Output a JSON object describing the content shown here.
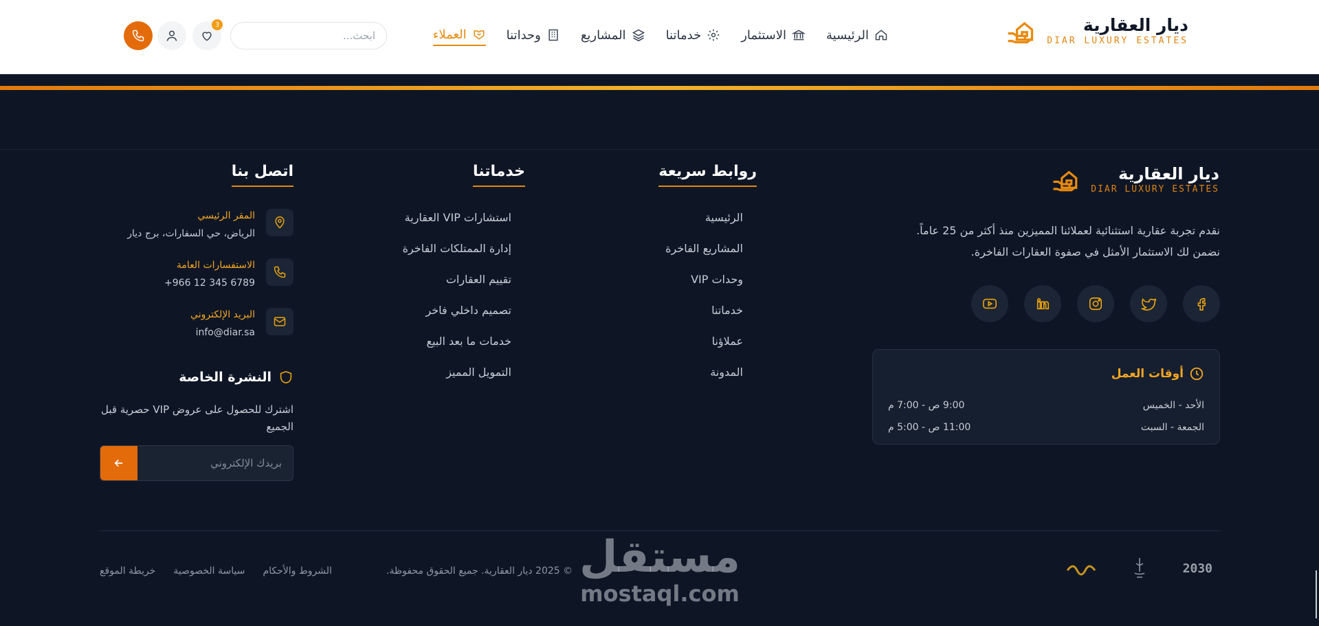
{
  "brand": {
    "title": "ديار العقارية",
    "subtitle": "DIAR LUXURY ESTATES"
  },
  "nav": [
    {
      "label": "الرئيسية",
      "icon": "home-icon"
    },
    {
      "label": "الاستثمار",
      "icon": "bank-icon"
    },
    {
      "label": "خدماتنا",
      "icon": "gear-icon"
    },
    {
      "label": "المشاريع",
      "icon": "layers-icon"
    },
    {
      "label": "وحداتنا",
      "icon": "building-icon"
    },
    {
      "label": "العملاء",
      "icon": "handshake-icon",
      "active": true
    }
  ],
  "search": {
    "placeholder": "ابحث..."
  },
  "header_actions": {
    "wishlist_count": "3"
  },
  "footer": {
    "about": {
      "title": "ديار العقارية",
      "subtitle": "DIAR LUXURY ESTATES",
      "description_line1": "نقدم تجربة عقارية استثنائية لعملائنا المميزين منذ أكثر من 25 عاماً.",
      "description_line2": "نضمن لك الاستثمار الأمثل في صفوة العقارات الفاخرة."
    },
    "socials": [
      "facebook-icon",
      "twitter-icon",
      "instagram-icon",
      "linkedin-icon",
      "youtube-icon"
    ],
    "hours": {
      "title": "أوقات العمل",
      "rows": [
        {
          "days": "الأحد - الخميس",
          "time": "9:00 ص - 7:00 م"
        },
        {
          "days": "الجمعة - السبت",
          "time": "11:00 ص - 5:00 م"
        }
      ]
    },
    "quick_links": {
      "title": "روابط سريعة",
      "items": [
        "الرئيسية",
        "المشاريع الفاخرة",
        "وحدات VIP",
        "خدماتنا",
        "عملاؤنا",
        "المدونة"
      ]
    },
    "services": {
      "title": "خدماتنا",
      "items": [
        "استشارات VIP العقارية",
        "إدارة الممتلكات الفاخرة",
        "تقييم العقارات",
        "تصميم داخلي فاخر",
        "خدمات ما بعد البيع",
        "التمويل المميز"
      ]
    },
    "contact": {
      "title": "اتصل بنا",
      "items": [
        {
          "label": "المقر الرئيسي",
          "value": "الرياض، حي السفارات، برج ديار",
          "icon": "location-pin-icon"
        },
        {
          "label": "الاستفسارات العامة",
          "value": "+966 12 345 6789",
          "icon": "phone-icon"
        },
        {
          "label": "البريد الإلكتروني",
          "value": "info@diar.sa",
          "icon": "mail-icon"
        }
      ]
    },
    "newsletter": {
      "title": "النشرة الخاصة",
      "description": "اشترك للحصول على عروض VIP حصرية قبل الجميع",
      "placeholder": "بريدك الإلكتروني"
    },
    "copyright": "© 2025 ديار العقارية. جميع الحقوق محفوظة.",
    "legal": [
      "الشروط والأحكام",
      "سياسة الخصوصية",
      "خريطة الموقع"
    ],
    "vision_text": "2030",
    "watermark_ar": "مستقل",
    "watermark_en": "mostaql.com"
  },
  "colors": {
    "accent": "#e58a0d",
    "call": "#e36b0a",
    "bg": "#0e1626"
  }
}
